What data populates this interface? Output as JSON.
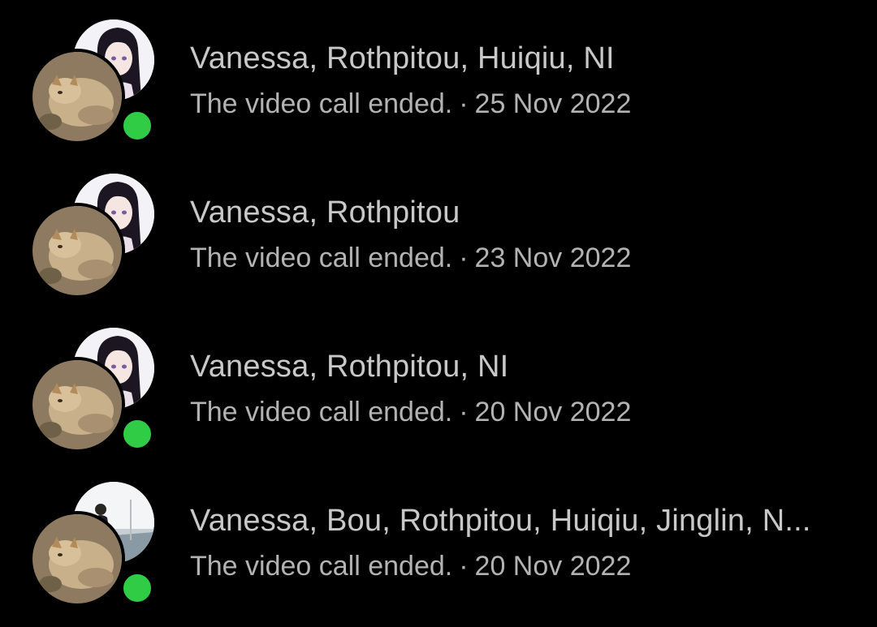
{
  "conversations": [
    {
      "name": "Vanessa, Rothpitou, Huiqiu, NI",
      "last_message": "The video call ended.",
      "separator": "·",
      "date": "25 Nov 2022",
      "online": true,
      "back_avatar": "anime-girl-avatar",
      "front_avatar": "dog-avatar"
    },
    {
      "name": "Vanessa, Rothpitou",
      "last_message": "The video call ended.",
      "separator": "·",
      "date": "23 Nov 2022",
      "online": false,
      "back_avatar": "anime-girl-avatar",
      "front_avatar": "dog-avatar"
    },
    {
      "name": "Vanessa, Rothpitou, NI",
      "last_message": "The video call ended.",
      "separator": "·",
      "date": "20 Nov 2022",
      "online": true,
      "back_avatar": "anime-girl-avatar",
      "front_avatar": "dog-avatar"
    },
    {
      "name": "Vanessa, Bou, Rothpitou, Huiqiu, Jinglin, N...",
      "last_message": "The video call ended.",
      "separator": "·",
      "date": "20 Nov 2022",
      "online": true,
      "back_avatar": "person-photo-avatar",
      "front_avatar": "dog-avatar"
    }
  ],
  "colors": {
    "background": "#000000",
    "name_text": "#c8c8c8",
    "sub_text": "#b3b3b3",
    "online": "#31cc46"
  }
}
